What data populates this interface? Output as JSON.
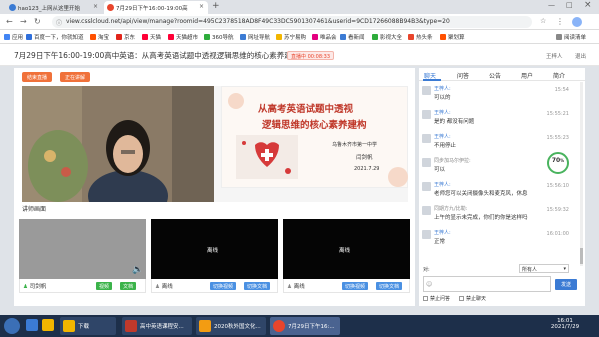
{
  "browser": {
    "tabs": [
      {
        "label": "hao123_上网从这里开始"
      },
      {
        "label": "7月29日下午16:00-19:00高"
      }
    ],
    "url": "view.csslcloud.net/api/view/manage?roomid=495C2378518AD8F49C33DC5901307461&userid=9CD17266088B94B3&type=20",
    "bookmarks": [
      "应用",
      "百度一下，你就知道",
      "淘宝",
      "京东",
      "天猫",
      "天猫超市",
      "360导航",
      "网址导航",
      "苏宁易购",
      "唯品会",
      "看新闻",
      "影视大全",
      "热头条",
      "聚划算",
      "阅读清单"
    ]
  },
  "page": {
    "title": "7月29日下午16:00-19:00高中英语：从高考英语试题中透视逻辑思维的核心素养建构",
    "live_badge": "直播中 00:08:33",
    "user": "王梓人",
    "exit": "退出"
  },
  "main": {
    "btn_end": "结束直播",
    "btn_doc": "正在讲解",
    "slide": {
      "line1": "从高考英语试题中透视",
      "line2": "逻辑思维的核心素养建构",
      "school": "乌鲁木齐市第一中学",
      "teacher": "闫剑帆",
      "date": "2021.7.29"
    },
    "section_title": "讲师画面",
    "video_slots": [
      {
        "name": "司剑帆",
        "btn1": "视频",
        "btn2": "文档",
        "offline": ""
      },
      {
        "name": "离线",
        "btn1": "切换视频",
        "btn2": "切换文档",
        "offline": "离线"
      },
      {
        "name": "离线",
        "btn1": "切换视频",
        "btn2": "切换文档",
        "offline": "离线"
      }
    ]
  },
  "chat": {
    "tabs": [
      "聊天",
      "问答",
      "公告",
      "用户",
      "简介"
    ],
    "messages": [
      {
        "name": "王梓人:",
        "text": "可以的",
        "time": "15:54"
      },
      {
        "name": "王梓人:",
        "text": "是的 都没有问题",
        "time": "15:55:21"
      },
      {
        "name": "王梓人:",
        "text": "不用停止",
        "time": "15:55:23"
      },
      {
        "name": "同步加马尔伊拉:",
        "text": "可以",
        "time": "15:55:31"
      },
      {
        "name": "王梓人:",
        "text": "老师您可以关闭摄像头和麦克风，休息",
        "time": "15:56:10"
      },
      {
        "name": "同期方九/比勒:",
        "text": "上午的显示未完成，你们的你是这样吗",
        "time": "15:59:32"
      },
      {
        "name": "王梓人:",
        "text": "正常",
        "time": "16:01:00"
      }
    ],
    "progress": "70",
    "progress_sub": "70%",
    "to_label": "对:",
    "to_select": "所有人",
    "send": "发送",
    "opt1": "禁止问答",
    "opt2": "禁止聊天"
  },
  "taskbar": {
    "items": [
      "下载",
      "高中英语课程安...",
      "2020秋外国文化...",
      "7月29日下午16:..."
    ],
    "time": "16:01",
    "date": "2021/7/29"
  }
}
